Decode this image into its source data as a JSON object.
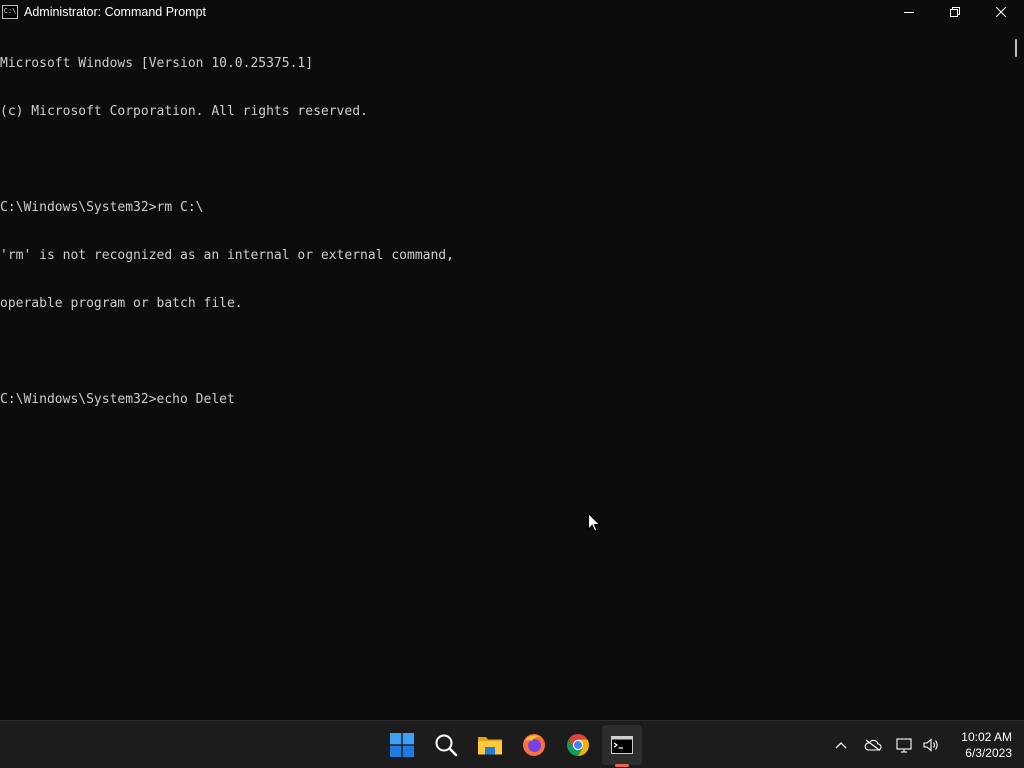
{
  "window": {
    "title": "Administrator: Command Prompt",
    "icon": "console-app-icon",
    "icon_text": "C:\\"
  },
  "controls": {
    "minimize": "minimize-icon",
    "restore": "restore-icon",
    "close": "close-icon"
  },
  "console": {
    "lines": [
      "Microsoft Windows [Version 10.0.25375.1]",
      "(c) Microsoft Corporation. All rights reserved.",
      "",
      "C:\\Windows\\System32>rm C:\\",
      "'rm' is not recognized as an internal or external command,",
      "operable program or batch file.",
      "",
      "C:\\Windows\\System32>echo Delet"
    ]
  },
  "taskbar": {
    "apps": [
      {
        "name": "start",
        "icon": "windows-logo-icon",
        "active": false
      },
      {
        "name": "search",
        "icon": "search-icon",
        "active": false
      },
      {
        "name": "file-explorer",
        "icon": "folder-icon",
        "active": false
      },
      {
        "name": "firefox",
        "icon": "firefox-icon",
        "active": false
      },
      {
        "name": "chrome",
        "icon": "chrome-icon",
        "active": false
      },
      {
        "name": "command-prompt",
        "icon": "terminal-icon",
        "active": true
      }
    ],
    "tray": [
      "chevron-up-icon",
      "onedrive-offline-icon",
      "network-icon",
      "volume-icon"
    ],
    "time": "10:02 AM",
    "date": "6/3/2023"
  },
  "colors": {
    "console_bg": "#0c0c0c",
    "console_text": "#cccccc",
    "taskbar_bg": "#1c1c1c",
    "active_indicator": "#e06a4f"
  }
}
